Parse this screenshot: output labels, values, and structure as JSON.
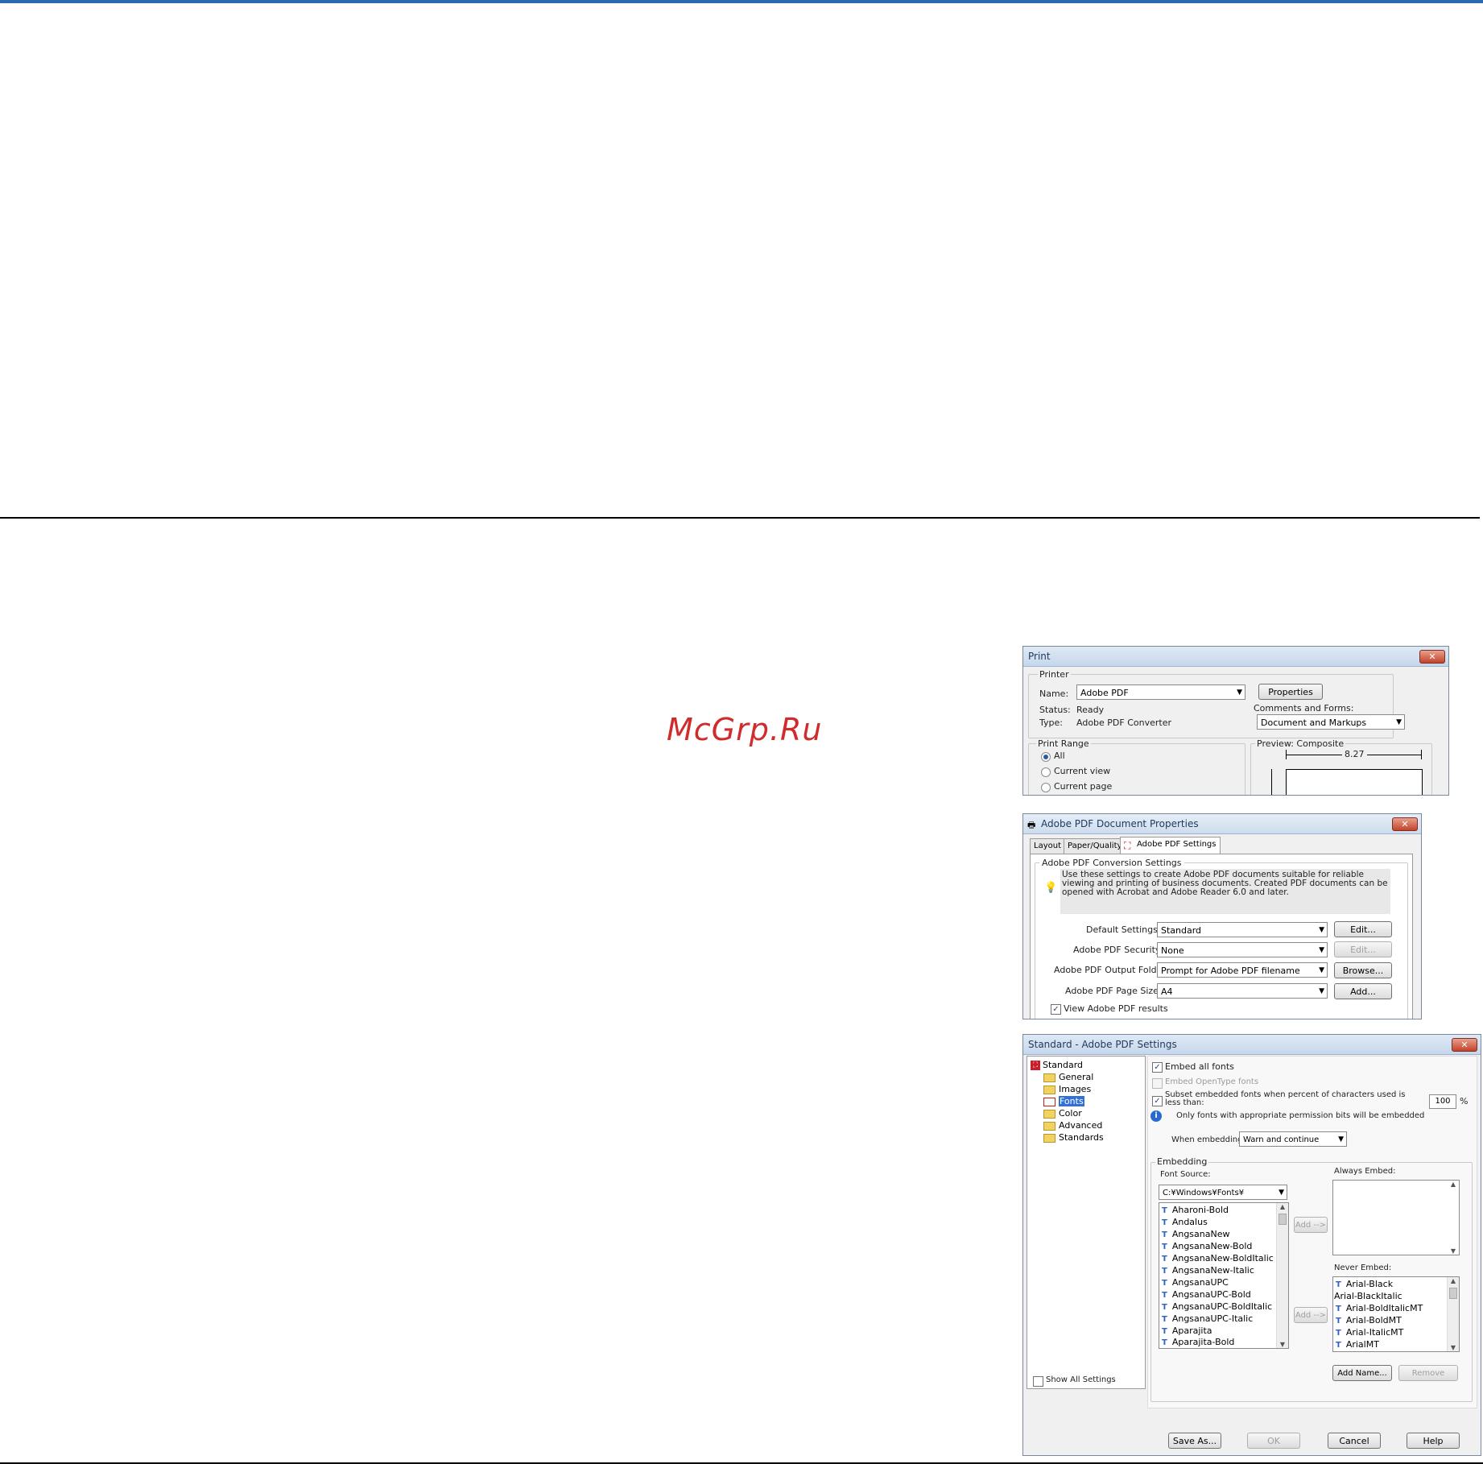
{
  "watermark": "McGrp.Ru",
  "print_dialog": {
    "title": "Print",
    "printer_group": "Printer",
    "name_label": "Name:",
    "name_value": "Adobe PDF",
    "properties_button": "Properties",
    "status_label": "Status:",
    "status_value": "Ready",
    "type_label": "Type:",
    "type_value": "Adobe PDF Converter",
    "comments_label": "Comments and Forms:",
    "comments_value": "Document and Markups",
    "print_range_label": "Print Range",
    "range_all": "All",
    "range_current_view": "Current view",
    "range_current_page": "Current page",
    "preview_label": "Preview: Composite",
    "preview_width": "8.27"
  },
  "doc_props": {
    "title": "Adobe PDF Document Properties",
    "tabs": [
      "Layout",
      "Paper/Quality",
      "Adobe PDF Settings"
    ],
    "group_label": "Adobe PDF Conversion Settings",
    "description": "Use these settings to create Adobe PDF documents suitable for reliable viewing and printing of business documents. Created PDF documents can be opened with Acrobat and Adobe Reader 6.0 and later.",
    "default_settings_label": "Default Settings:",
    "default_settings_value": "Standard",
    "edit_button": "Edit...",
    "security_label": "Adobe PDF Security:",
    "security_value": "None",
    "edit_button_disabled": "Edit...",
    "output_folder_label": "Adobe PDF Output Folder",
    "output_folder_value": "Prompt for Adobe PDF filename",
    "browse_button": "Browse...",
    "page_size_label": "Adobe PDF Page Size:",
    "page_size_value": "A4",
    "add_button": "Add...",
    "view_results_label": "View Adobe PDF results"
  },
  "pdf_settings": {
    "title": "Standard - Adobe PDF Settings",
    "tree_root": "Standard",
    "tree_items": [
      "General",
      "Images",
      "Fonts",
      "Color",
      "Advanced",
      "Standards"
    ],
    "embed_all_fonts": "Embed all fonts",
    "embed_opentype": "Embed OpenType fonts",
    "subset_label": "Subset embedded fonts when percent of characters used is less than:",
    "subset_value": "100",
    "subset_unit": "%",
    "permission_note": "Only fonts with appropriate permission bits will be embedded",
    "when_embedding_label": "When embedding:",
    "when_embedding_value": "Warn and continue",
    "embedding_group": "Embedding",
    "font_source_label": "Font Source:",
    "font_source_value": "C:¥Windows¥Fonts¥",
    "font_list": [
      "Aharoni-Bold",
      "Andalus",
      "AngsanaNew",
      "AngsanaNew-Bold",
      "AngsanaNew-BoldItalic",
      "AngsanaNew-Italic",
      "AngsanaUPC",
      "AngsanaUPC-Bold",
      "AngsanaUPC-BoldItalic",
      "AngsanaUPC-Italic",
      "Aparajita",
      "Aparajita-Bold"
    ],
    "add_button_1": "Add -->",
    "add_button_2": "Add -->",
    "always_embed_label": "Always Embed:",
    "never_embed_label": "Never Embed:",
    "never_embed_list": [
      "Arial-Black",
      "Arial-BlackItalic",
      "Arial-BoldItalicMT",
      "Arial-BoldMT",
      "Arial-ItalicMT",
      "ArialMT"
    ],
    "add_name_button": "Add Name...",
    "remove_button": "Remove",
    "show_all_settings": "Show All Settings",
    "save_as_button": "Save As...",
    "ok_button": "OK",
    "cancel_button": "Cancel",
    "help_button": "Help"
  }
}
